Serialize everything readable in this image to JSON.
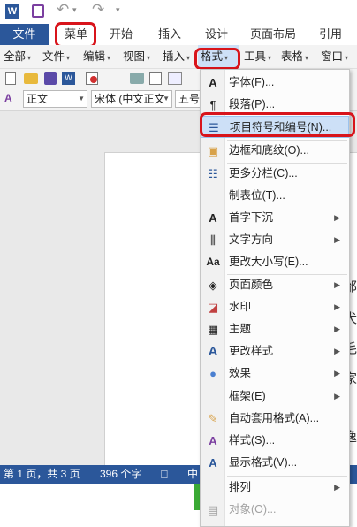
{
  "quick_access": {
    "undo_caret": "▾",
    "customize": "▾"
  },
  "ribbon_tabs": [
    "文件",
    "菜单",
    "开始",
    "插入",
    "设计",
    "页面布局",
    "引用"
  ],
  "menubar": [
    "全部",
    "文件",
    "编辑",
    "视图",
    "插入",
    "格式",
    "工具",
    "表格",
    "窗口"
  ],
  "format_bar": {
    "style": "正文",
    "font": "宋体 (中文正文",
    "size": "五号"
  },
  "status": {
    "page": "第 1 页，共 3 页",
    "words": "396 个字",
    "lang": "中"
  },
  "menu_items": [
    {
      "icon": "A",
      "label": "字体(F)...",
      "submenu": false,
      "disabled": false
    },
    {
      "icon": "¶",
      "label": "段落(P)...",
      "submenu": false,
      "disabled": false
    },
    {
      "icon": "☰",
      "label": "项目符号和编号(N)...",
      "submenu": false,
      "disabled": false
    },
    {
      "icon": "▣",
      "label": "边框和底纹(O)...",
      "submenu": false,
      "disabled": false
    },
    {
      "icon": "☷",
      "label": "更多分栏(C)...",
      "submenu": false,
      "disabled": false
    },
    {
      "icon": "",
      "label": "制表位(T)...",
      "submenu": false,
      "disabled": false
    },
    {
      "icon": "A",
      "label": "首字下沉",
      "submenu": true,
      "disabled": false
    },
    {
      "icon": "⫼",
      "label": "文字方向",
      "submenu": true,
      "disabled": false
    },
    {
      "icon": "Aa",
      "label": "更改大小写(E)...",
      "submenu": false,
      "disabled": false
    },
    {
      "icon": "◈",
      "label": "页面颜色",
      "submenu": true,
      "disabled": false
    },
    {
      "icon": "◪",
      "label": "水印",
      "submenu": true,
      "disabled": false
    },
    {
      "icon": "▦",
      "label": "主题",
      "submenu": true,
      "disabled": false
    },
    {
      "icon": "A",
      "label": "更改样式",
      "submenu": true,
      "disabled": false
    },
    {
      "icon": "●",
      "label": "效果",
      "submenu": true,
      "disabled": false
    },
    {
      "icon": "",
      "label": "框架(E)",
      "submenu": true,
      "disabled": false
    },
    {
      "icon": "✎",
      "label": "自动套用格式(A)...",
      "submenu": false,
      "disabled": false
    },
    {
      "icon": "A",
      "label": "样式(S)...",
      "submenu": false,
      "disabled": false
    },
    {
      "icon": "A",
      "label": "显示格式(V)...",
      "submenu": false,
      "disabled": false
    },
    {
      "icon": "",
      "label": "排列",
      "submenu": true,
      "disabled": false
    },
    {
      "icon": "▤",
      "label": "对象(O)...",
      "submenu": false,
      "disabled": true
    }
  ],
  "doc_glyphs": [
    "邰",
    "犬",
    "毛",
    "家",
    "逸"
  ],
  "colors": {
    "accent": "#2b579a",
    "highlight_ring": "#d8141b",
    "menu_hover": "#cde0f7"
  }
}
